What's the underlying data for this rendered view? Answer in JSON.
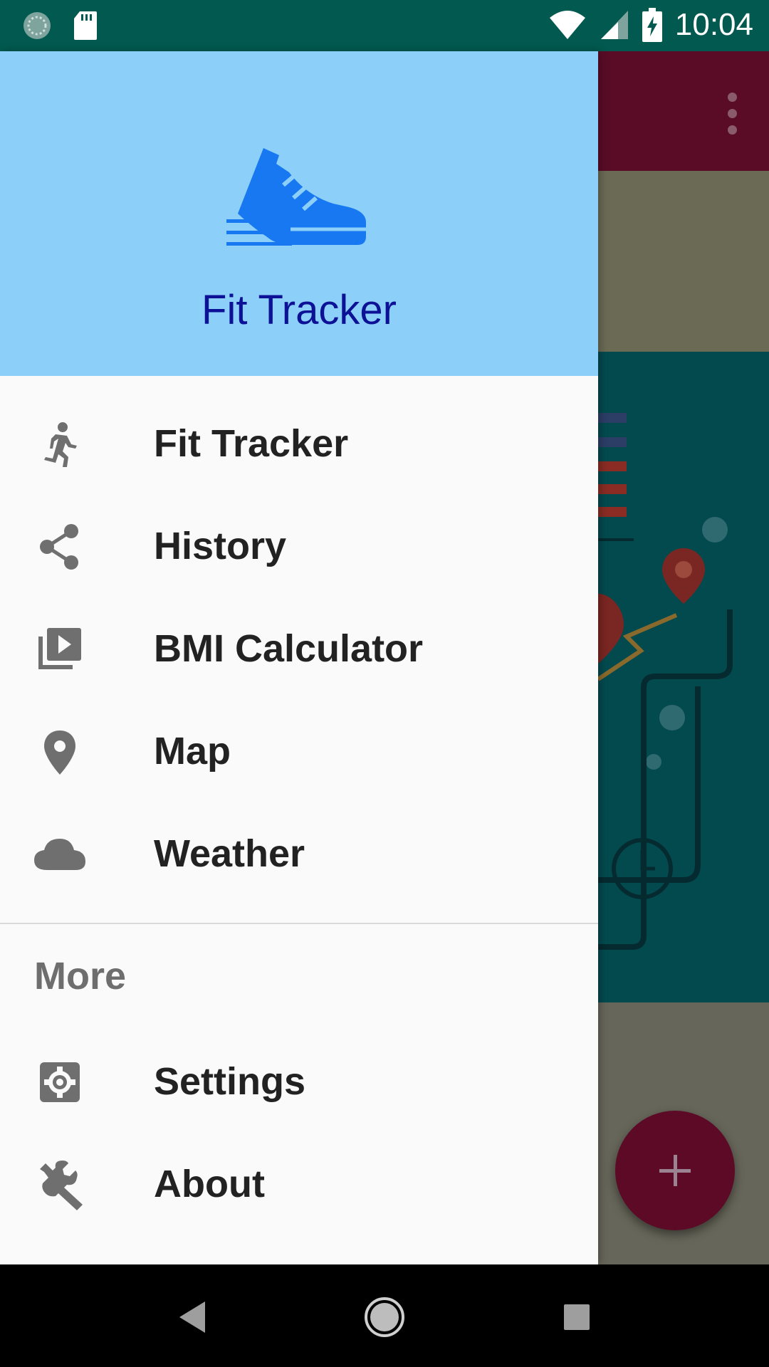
{
  "status_bar": {
    "time": "10:04",
    "icons": [
      "sync-icon",
      "sd-card-icon",
      "wifi-icon",
      "cell-signal-icon",
      "battery-charging-icon"
    ]
  },
  "drawer": {
    "header_title": "Fit Tracker",
    "logo_icon": "running-shoe-icon",
    "items": [
      {
        "label": "Fit Tracker",
        "icon": "directions-run-icon"
      },
      {
        "label": "History",
        "icon": "share-icon"
      },
      {
        "label": "BMI Calculator",
        "icon": "video-library-icon"
      },
      {
        "label": "Map",
        "icon": "location-pin-icon"
      },
      {
        "label": "Weather",
        "icon": "cloud-icon"
      }
    ],
    "section_title": "More",
    "more_items": [
      {
        "label": "Settings",
        "icon": "settings-icon"
      },
      {
        "label": "About",
        "icon": "wrench-icon"
      }
    ]
  },
  "colors": {
    "status_bar": "#02594f",
    "drawer_header": "#8ccff9",
    "header_title": "#0c1196",
    "logo_blue": "#1778f2",
    "fab": "#5c0a26",
    "app_toolbar": "#5a0c26"
  },
  "navigation": [
    "back-icon",
    "home-icon",
    "recents-icon"
  ]
}
